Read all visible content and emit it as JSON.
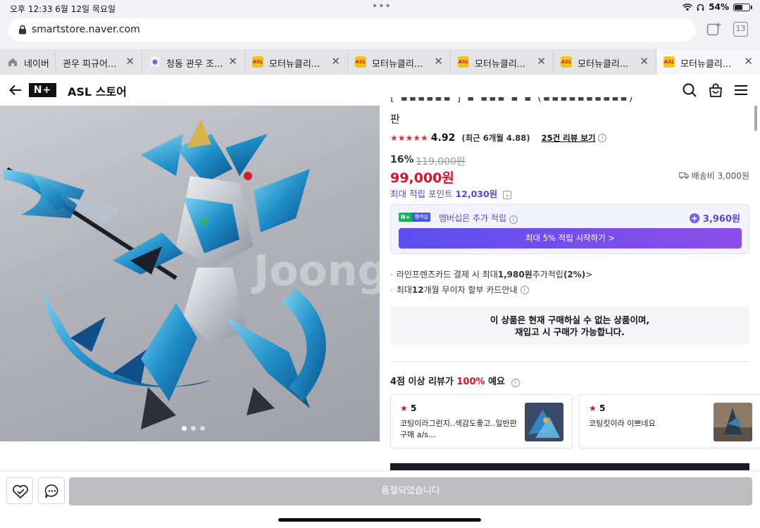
{
  "status_bar": {
    "time_date": "오후 12:33   6월 12일 목요일",
    "battery": "54%",
    "battery_level": 0.54
  },
  "browser": {
    "url": "smartstore.naver.com",
    "tab_count": "13",
    "tabs": [
      {
        "label": "네이버",
        "icon": "home-icon"
      },
      {
        "label": "관우 피규어...",
        "icon": "none"
      },
      {
        "label": "청동 관우 조...",
        "icon": "site-favicon"
      },
      {
        "label": "모터뉴클리...",
        "icon": "asl-favicon"
      },
      {
        "label": "모터뉴클리...",
        "icon": "asl-favicon"
      },
      {
        "label": "모터뉴클리...",
        "icon": "asl-favicon"
      },
      {
        "label": "모터뉴클리...",
        "icon": "asl-favicon"
      },
      {
        "label": "모터뉴클리...",
        "icon": "asl-favicon"
      }
    ],
    "asl_icon_text": "ASL"
  },
  "store_header": {
    "logo": "N+",
    "store_name": "ASL 스토어"
  },
  "product": {
    "title_tail": "판",
    "rating_stars": "★★★★★",
    "rating_score": "4.92",
    "recent_rating": "(최근 6개월 4.88)",
    "review_link": "25건 리뷰 보기",
    "discount": "16%",
    "original_price": "119,000원",
    "price": "99,000원",
    "shipping": "배송비 3,000원",
    "points_label": "최대 적립 포인트",
    "points_value": "12,030원",
    "watermark": "Joongg"
  },
  "membership": {
    "badge_n": "N+",
    "badge_label": "멤버십",
    "text": "멤버십은 추가 적립",
    "points": "3,960원",
    "cta": "최대 5% 적립 시작하기 >"
  },
  "card_offers": [
    {
      "prefix": "라인프렌즈카드 결제 시 최대 ",
      "bold": "1,980원",
      "suffix": " 추가적립 ",
      "bold2": "(2%)",
      "tail": " >"
    },
    {
      "prefix": "최대 ",
      "bold": "12",
      "suffix": "개월 무이자 할부 카드안내",
      "bold2": "",
      "tail": ""
    }
  ],
  "soldout_notice": {
    "line1": "이 상품은 현재 구매하실 수 없는 상품이며,",
    "line2": "재입고 시 구매가 가능합니다."
  },
  "reviews": {
    "heading_prefix": "4점 이상 리뷰가 ",
    "heading_pct": "100%",
    "heading_suffix": " 예요",
    "items": [
      {
        "score": "5",
        "text": "코팅이라그런지..색감도좋고..일반판 구매 a/s..."
      },
      {
        "score": "5",
        "text": "코팅킷이라 이쁘네요"
      }
    ]
  },
  "bottom_bar": {
    "soldout_button": "품절되었습니다"
  },
  "colors": {
    "price_red": "#e0102a",
    "point_purple": "#5a49d6",
    "membership_gradient_start": "#5b4ff0",
    "membership_gradient_end": "#8c4ee8",
    "soldout_gray": "#bdbdc0"
  }
}
